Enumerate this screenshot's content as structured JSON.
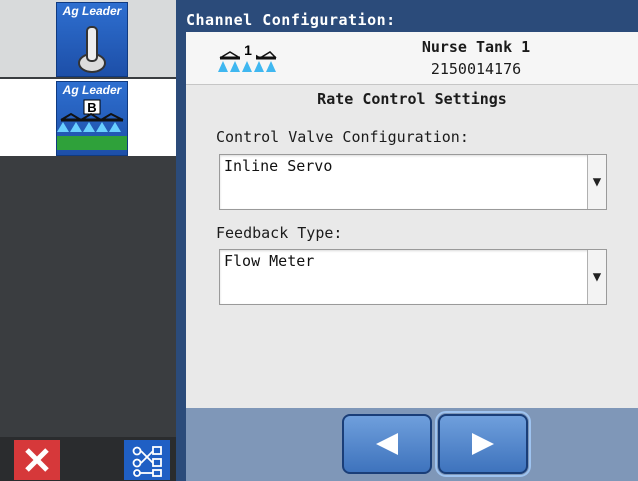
{
  "sidebar": {
    "tiles": [
      {
        "brand": "Ag Leader",
        "icon": "toggle-switch-icon"
      },
      {
        "brand": "Ag Leader",
        "icon": "sprayer-boom-b-icon",
        "letter": "B"
      }
    ],
    "cancel_icon": "close-icon",
    "menu_icon": "network-diagram-icon"
  },
  "window": {
    "title": "Channel Configuration:"
  },
  "device": {
    "name": "Nurse Tank 1",
    "serial": "2150014176",
    "icon": "sprayer-channel-1-icon",
    "channel_number": "1"
  },
  "section": {
    "title": "Rate Control Settings"
  },
  "fields": {
    "control_valve": {
      "label": "Control Valve Configuration:",
      "value": "Inline Servo"
    },
    "feedback_type": {
      "label": "Feedback Type:",
      "value": "Flow Meter"
    }
  },
  "nav": {
    "prev_icon": "arrow-left-icon",
    "next_icon": "arrow-right-icon"
  },
  "colors": {
    "brand_blue": "#1f5fc4",
    "panel_navy": "#2b4b7a",
    "cancel_red": "#d6383a"
  }
}
